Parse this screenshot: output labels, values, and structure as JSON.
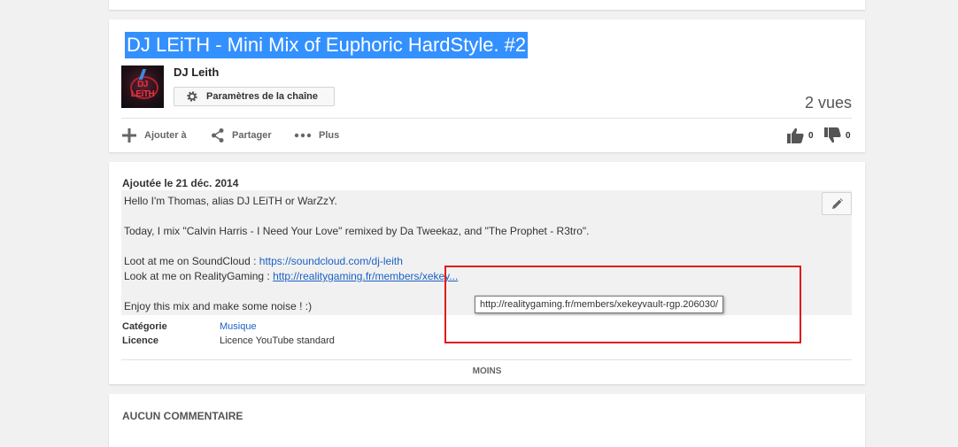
{
  "video": {
    "title": "DJ LEiTH - Mini Mix of Euphoric HardStyle. #2",
    "views": "2 vues"
  },
  "channel": {
    "name": "DJ Leith",
    "avatar_text": "DJ LEiTH",
    "settings_button": "Paramètres de la chaîne"
  },
  "actions": {
    "add_to": "Ajouter à",
    "share": "Partager",
    "more": "Plus",
    "likes": "0",
    "dislikes": "0"
  },
  "description": {
    "published": "Ajoutée le 21 déc. 2014",
    "line1": "Hello I'm Thomas, alias DJ LEiTH or WarZzY.",
    "line2": "Today, I mix \"Calvin Harris - I Need Your Love\" remixed by Da Tweekaz, and \"The Prophet - R3tro\".",
    "soundcloud_prefix": "Loot at me on SoundCloud : ",
    "soundcloud_link": "https://soundcloud.com/dj-leith",
    "realitygaming_prefix": "Look at me on RealityGaming : ",
    "realitygaming_link": "http://realitygaming.fr/members/xekey...",
    "line5": "Enjoy this mix and make some noise ! :)",
    "category_label": "Catégorie",
    "category_value": "Musique",
    "license_label": "Licence",
    "license_value": "Licence YouTube standard",
    "less_button": "MOINS"
  },
  "tooltip": {
    "text": "http://realitygaming.fr/members/xekeyvault-rgp.206030/"
  },
  "comments": {
    "title": "AUCUN COMMENTAIRE"
  },
  "colors": {
    "selection": "#3390ff",
    "link": "#1b61c4",
    "highlight_box": "#e11a1a"
  }
}
